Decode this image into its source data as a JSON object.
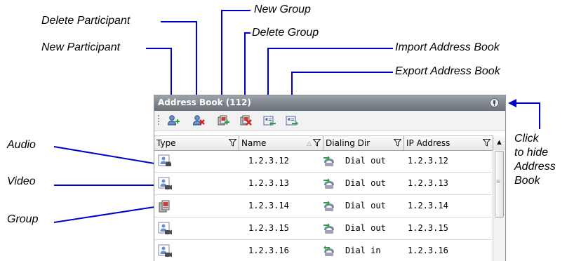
{
  "callouts": {
    "delete_participant": "Delete Participant",
    "new_group": "New Group",
    "delete_group": "Delete Group",
    "new_participant": "New Participant",
    "import_address_book": "Import Address Book",
    "export_address_book": "Export Address Book",
    "click_to_hide": [
      "Click",
      "to hide",
      "Address",
      "Book"
    ],
    "audio": "Audio",
    "video": "Video",
    "group": "Group"
  },
  "panel": {
    "title": "Address Book (112)",
    "columns": {
      "type": "Type",
      "name": "Name",
      "dialing_dir": "Dialing Dir",
      "ip_address": "IP Address"
    },
    "rows": [
      {
        "type": "audio",
        "name": "1.2.3.12",
        "dialing_dir": "Dial out",
        "ip_address": "1.2.3.12"
      },
      {
        "type": "video",
        "name": "1.2.3.13",
        "dialing_dir": "Dial out",
        "ip_address": "1.2.3.13"
      },
      {
        "type": "group",
        "name": "1.2.3.14",
        "dialing_dir": "Dial out",
        "ip_address": "1.2.3.14"
      },
      {
        "type": "video",
        "name": "1.2.3.15",
        "dialing_dir": "Dial out",
        "ip_address": "1.2.3.15"
      },
      {
        "type": "video",
        "name": "1.2.3.16",
        "dialing_dir": "Dial in",
        "ip_address": "1.2.3.16"
      }
    ]
  },
  "colors": {
    "callout_line": "#0000cc",
    "titlebar": "#7c838b"
  }
}
